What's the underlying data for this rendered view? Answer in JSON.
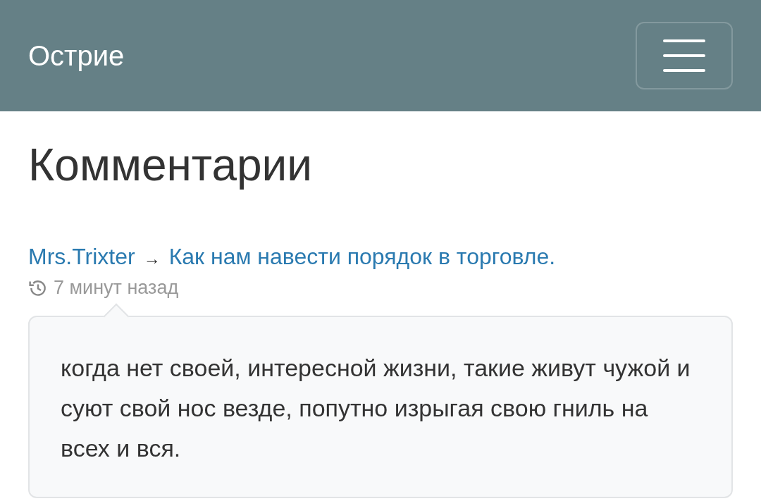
{
  "navbar": {
    "brand": "Острие"
  },
  "heading": "Комментарии",
  "comments": [
    {
      "author": "Mrs.Trixter",
      "separator": "→",
      "post_title": "Как нам навести порядок в торговле.",
      "time": "7 минут назад",
      "text": "когда нет своей, интересной жизни, такие живут чужой и суют свой нос везде, попутно изрыгая свою гниль на всех и вся."
    }
  ]
}
